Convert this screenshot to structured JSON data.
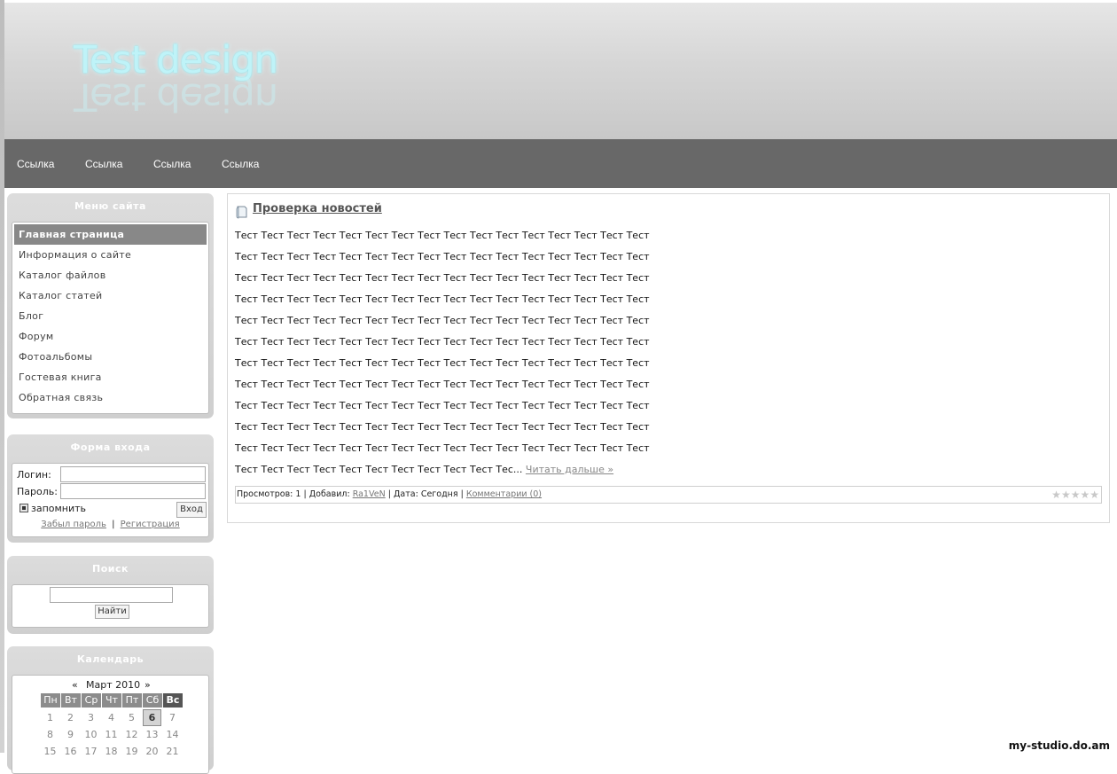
{
  "logo": {
    "text": "Test design"
  },
  "nav": {
    "links": [
      "Ссылка",
      "Ссылка",
      "Ссылка",
      "Ссылка"
    ]
  },
  "menu_block": {
    "title": "Меню сайта",
    "items": [
      "Главная страница",
      "Информация о сайте",
      "Каталог файлов",
      "Каталог статей",
      "Блог",
      "Форум",
      "Фотоальбомы",
      "Гостевая книга",
      "Обратная связь"
    ],
    "active_index": 0
  },
  "login_block": {
    "title": "Форма входа",
    "login_label": "Логин:",
    "password_label": "Пароль:",
    "login_value": "",
    "password_value": "",
    "remember_label": "запомнить",
    "submit_label": "Вход",
    "forgot_label": "Забыл пароль",
    "separator": "|",
    "register_label": "Регистрация"
  },
  "search_block": {
    "title": "Поиск",
    "input_value": "",
    "submit_label": "Найти"
  },
  "calendar_block": {
    "title": "Календарь",
    "prev": "«",
    "month_label": "Март 2010",
    "next": "»",
    "weekdays": [
      "Пн",
      "Вт",
      "Ср",
      "Чт",
      "Пт",
      "Сб",
      "Вс"
    ],
    "rows": [
      [
        "1",
        "2",
        "3",
        "4",
        "5",
        "6",
        "7"
      ],
      [
        "8",
        "9",
        "10",
        "11",
        "12",
        "13",
        "14"
      ],
      [
        "15",
        "16",
        "17",
        "18",
        "19",
        "20",
        "21"
      ]
    ],
    "today": "6"
  },
  "post": {
    "title": "Проверка новостей",
    "lines": [
      "Тест Тест Тест Тест Тест Тест Тест Тест Тест Тест Тест Тест Тест Тест Тест Тест",
      "Тест Тест Тест Тест Тест Тест Тест Тест Тест Тест Тест Тест Тест Тест Тест Тест",
      "Тест Тест Тест Тест Тест Тест Тест Тест Тест Тест Тест Тест Тест Тест Тест Тест",
      "Тест Тест Тест Тест Тест Тест Тест Тест Тест Тест Тест Тест Тест Тест Тест Тест",
      "Тест Тест Тест Тест Тест Тест Тест Тест Тест Тест Тест Тест Тест Тест Тест Тест",
      "Тест Тест Тест Тест Тест Тест Тест Тест Тест Тест Тест Тест Тест Тест Тест Тест",
      "Тест Тест Тест Тест Тест Тест Тест Тест Тест Тест Тест Тест Тест Тест Тест Тест",
      "Тест Тест Тест Тест Тест Тест Тест Тест Тест Тест Тест Тест Тест Тест Тест Тест",
      "Тест Тест Тест Тест Тест Тест Тест Тест Тест Тест Тест Тест Тест Тест Тест Тест",
      "Тест Тест Тест Тест Тест Тест Тест Тест Тест Тест Тест Тест Тест Тест Тест Тест",
      "Тест Тест Тест Тест Тест Тест Тест Тест Тест Тест Тест Тест Тест Тест Тест Тест"
    ],
    "last_line": "Тест Тест Тест Тест Тест Тест Тест Тест Тест Тест Тес...",
    "read_more": "Читать дальше »",
    "footer": {
      "views_label": "Просмотров:",
      "views": "1",
      "added_label": "Добавил:",
      "author": "Ra1VeN",
      "date_label": "Дата:",
      "date": "Сегодня",
      "comments": "Комментарии (0)",
      "separator": "|"
    },
    "rating_stars": 5
  },
  "watermark": "my-studio.do.am",
  "colors": {
    "nav_bg": "#686868",
    "active_menu_bg": "#888888",
    "block_bg": "#d6d6d6",
    "logo_color": "#bff3f8"
  }
}
